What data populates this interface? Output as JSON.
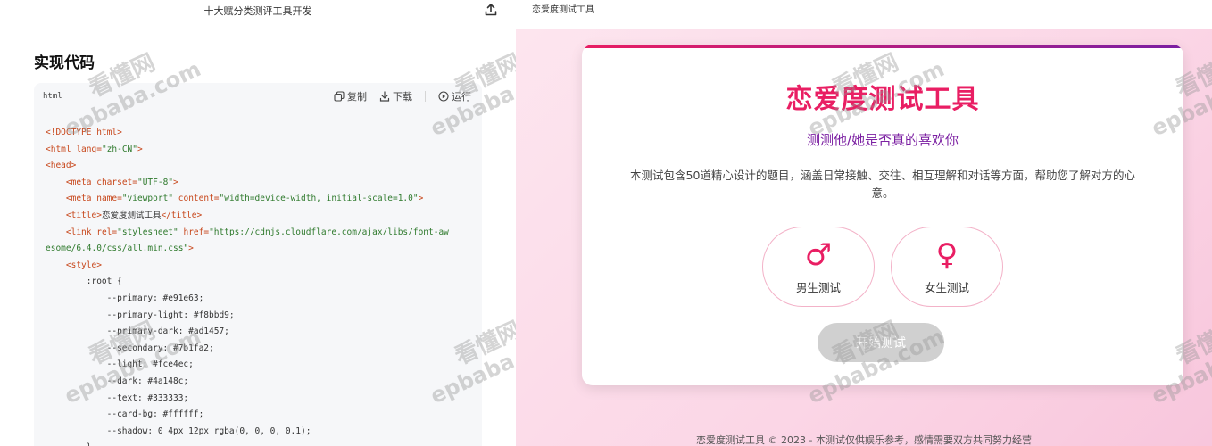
{
  "left_pane": {
    "doc_title": "十大赋分类测评工具开发",
    "section_heading": "实现代码",
    "code_block": {
      "language": "html",
      "actions": {
        "copy": "复制",
        "download": "下载",
        "run": "运行"
      },
      "lines": [
        [
          [
            "tag",
            "<!DOCTYPE html>"
          ]
        ],
        [
          [
            "tag",
            "<html "
          ],
          [
            "attr",
            "lang="
          ],
          [
            "str",
            "\"zh-CN\""
          ],
          [
            "tag",
            ">"
          ]
        ],
        [
          [
            "tag",
            "<head>"
          ]
        ],
        [
          [
            "plain",
            "    "
          ],
          [
            "tag",
            "<meta "
          ],
          [
            "attr",
            "charset="
          ],
          [
            "str",
            "\"UTF-8\""
          ],
          [
            "tag",
            ">"
          ]
        ],
        [
          [
            "plain",
            "    "
          ],
          [
            "tag",
            "<meta "
          ],
          [
            "attr",
            "name="
          ],
          [
            "str",
            "\"viewport\""
          ],
          [
            "attr",
            " content="
          ],
          [
            "str",
            "\"width=device-width, initial-scale=1.0\""
          ],
          [
            "tag",
            ">"
          ]
        ],
        [
          [
            "plain",
            "    "
          ],
          [
            "tag",
            "<title>"
          ],
          [
            "plain",
            "恋爱度测试工具"
          ],
          [
            "tag",
            "</title>"
          ]
        ],
        [
          [
            "plain",
            "    "
          ],
          [
            "tag",
            "<link "
          ],
          [
            "attr",
            "rel="
          ],
          [
            "str",
            "\"stylesheet\""
          ],
          [
            "attr",
            " href="
          ],
          [
            "str",
            "\"https://cdnjs.cloudflare.com/ajax/libs/font-aw"
          ]
        ],
        [
          [
            "str",
            "esome/6.4.0/css/all.min.css\""
          ],
          [
            "tag",
            ">"
          ]
        ],
        [
          [
            "plain",
            "    "
          ],
          [
            "tag",
            "<style>"
          ]
        ],
        [
          [
            "plain",
            "        :root {"
          ]
        ],
        [
          [
            "plain",
            "            --primary: #e91e63;"
          ]
        ],
        [
          [
            "plain",
            "            --primary-light: #f8bbd9;"
          ]
        ],
        [
          [
            "plain",
            "            --primary-dark: #ad1457;"
          ]
        ],
        [
          [
            "plain",
            "            --secondary: #7b1fa2;"
          ]
        ],
        [
          [
            "plain",
            "            --light: #fce4ec;"
          ]
        ],
        [
          [
            "plain",
            "            --dark: #4a148c;"
          ]
        ],
        [
          [
            "plain",
            "            --text: #333333;"
          ]
        ],
        [
          [
            "plain",
            "            --card-bg: #ffffff;"
          ]
        ],
        [
          [
            "plain",
            "            --shadow: 0 4px 12px rgba(0, 0, 0, 0.1);"
          ]
        ],
        [
          [
            "plain",
            "        }"
          ]
        ]
      ]
    }
  },
  "preview": {
    "header_title": "恋爱度测试工具",
    "card": {
      "title": "恋爱度测试工具",
      "subtitle": "测测他/她是否真的喜欢你",
      "description": "本测试包含50道精心设计的题目，涵盖日常接触、交往、相互理解和对话等方面，帮助您了解对方的心意。",
      "male_icon": "♂",
      "male_label": "男生测试",
      "female_icon": "♀",
      "female_label": "女生测试",
      "start_label": "开始测试"
    },
    "footer": "恋爱度测试工具 © 2023 - 本测试仅供娱乐参考，感情需要双方共同努力经营"
  },
  "watermark": {
    "cn": "看懂网",
    "en": "epbaba.com"
  },
  "colors": {
    "primary": "#e91e63",
    "secondary": "#7b1fa2",
    "start_disabled": "#d0d0d0"
  },
  "icons": [
    "upload-icon",
    "copy-icon",
    "download-icon",
    "run-icon",
    "male-icon",
    "female-icon"
  ]
}
